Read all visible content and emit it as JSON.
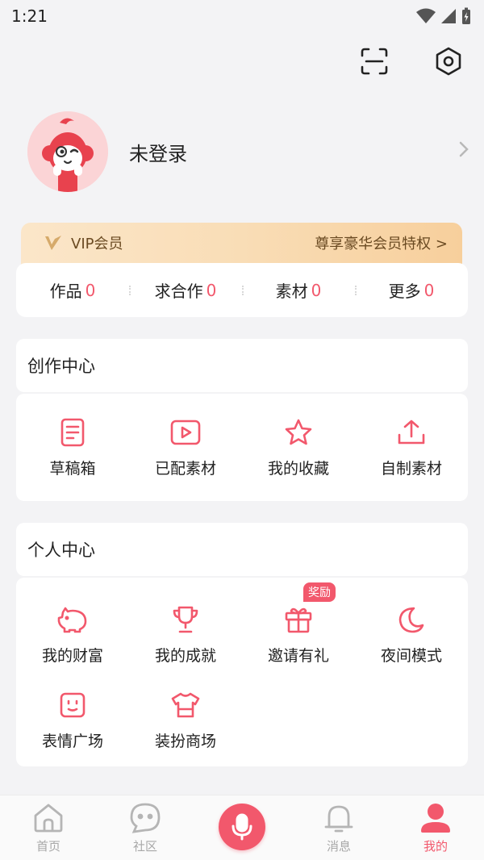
{
  "status_bar": {
    "time": "1:21"
  },
  "profile": {
    "username": "未登录"
  },
  "vip": {
    "label": "VIP会员",
    "privilege_link": "尊享豪华会员特权 >"
  },
  "stats": [
    {
      "label": "作品",
      "count": "0"
    },
    {
      "label": "求合作",
      "count": "0"
    },
    {
      "label": "素材",
      "count": "0"
    },
    {
      "label": "更多",
      "count": "0"
    }
  ],
  "creation_center": {
    "title": "创作中心",
    "items": [
      {
        "label": "草稿箱",
        "icon": "drafts-icon"
      },
      {
        "label": "已配素材",
        "icon": "play-video-icon"
      },
      {
        "label": "我的收藏",
        "icon": "star-icon"
      },
      {
        "label": "自制素材",
        "icon": "upload-icon"
      }
    ]
  },
  "personal_center": {
    "title": "个人中心",
    "reward_badge": "奖励",
    "items": [
      {
        "label": "我的财富",
        "icon": "piggy-bank-icon"
      },
      {
        "label": "我的成就",
        "icon": "trophy-icon"
      },
      {
        "label": "邀请有礼",
        "icon": "gift-icon"
      },
      {
        "label": "夜间模式",
        "icon": "moon-icon"
      },
      {
        "label": "表情广场",
        "icon": "emoji-icon"
      },
      {
        "label": "装扮商场",
        "icon": "tshirt-icon"
      }
    ]
  },
  "bottom_nav": [
    {
      "label": "首页",
      "icon": "home-icon"
    },
    {
      "label": "社区",
      "icon": "community-icon"
    },
    {
      "label": "消息",
      "icon": "bell-icon"
    },
    {
      "label": "我的",
      "icon": "profile-icon",
      "active": true
    }
  ],
  "colors": {
    "accent": "#f2586c",
    "background": "#f3f3f5",
    "vip_gold": "#f7cf9c"
  }
}
